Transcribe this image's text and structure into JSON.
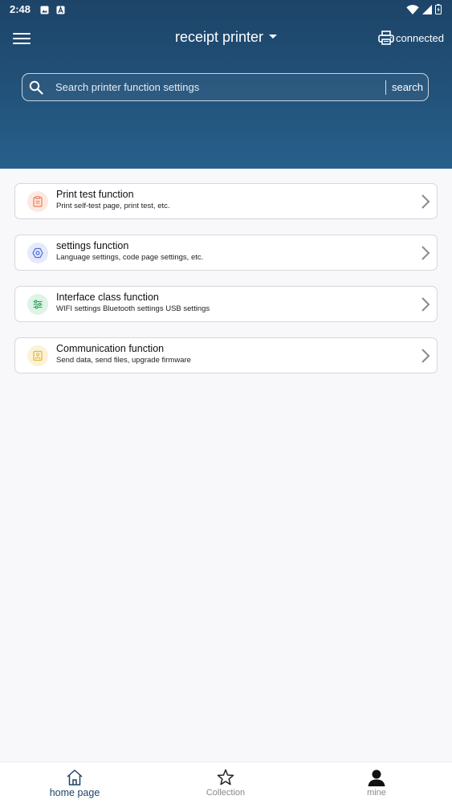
{
  "status_bar": {
    "time": "2:48"
  },
  "header": {
    "title": "receipt printer",
    "connection_label": "connected"
  },
  "search": {
    "placeholder": "Search printer function settings",
    "button_label": "search"
  },
  "menu_items": [
    {
      "title": "Print test function",
      "subtitle": "Print self-test page, print test, etc.",
      "icon": "clipboard-icon",
      "icon_color": "#ef7a52",
      "icon_bg": "#fde9e2"
    },
    {
      "title": "settings function",
      "subtitle": "Language settings, code page settings, etc.",
      "icon": "hexagon-gear-icon",
      "icon_color": "#4d6fdc",
      "icon_bg": "#e5eafb"
    },
    {
      "title": "Interface class function",
      "subtitle": "WIFI settings Bluetooth settings USB settings",
      "icon": "sliders-icon",
      "icon_color": "#2fa45f",
      "icon_bg": "#dff3e6"
    },
    {
      "title": "Communication function",
      "subtitle": "Send data, send files, upgrade firmware",
      "icon": "image-file-icon",
      "icon_color": "#e3b83a",
      "icon_bg": "#fbf2d8"
    }
  ],
  "tabbar": {
    "home_label": "home page",
    "collection_label": "Collection",
    "mine_label": "mine",
    "active_color": "#1d4468",
    "inactive_color": "#888888"
  }
}
